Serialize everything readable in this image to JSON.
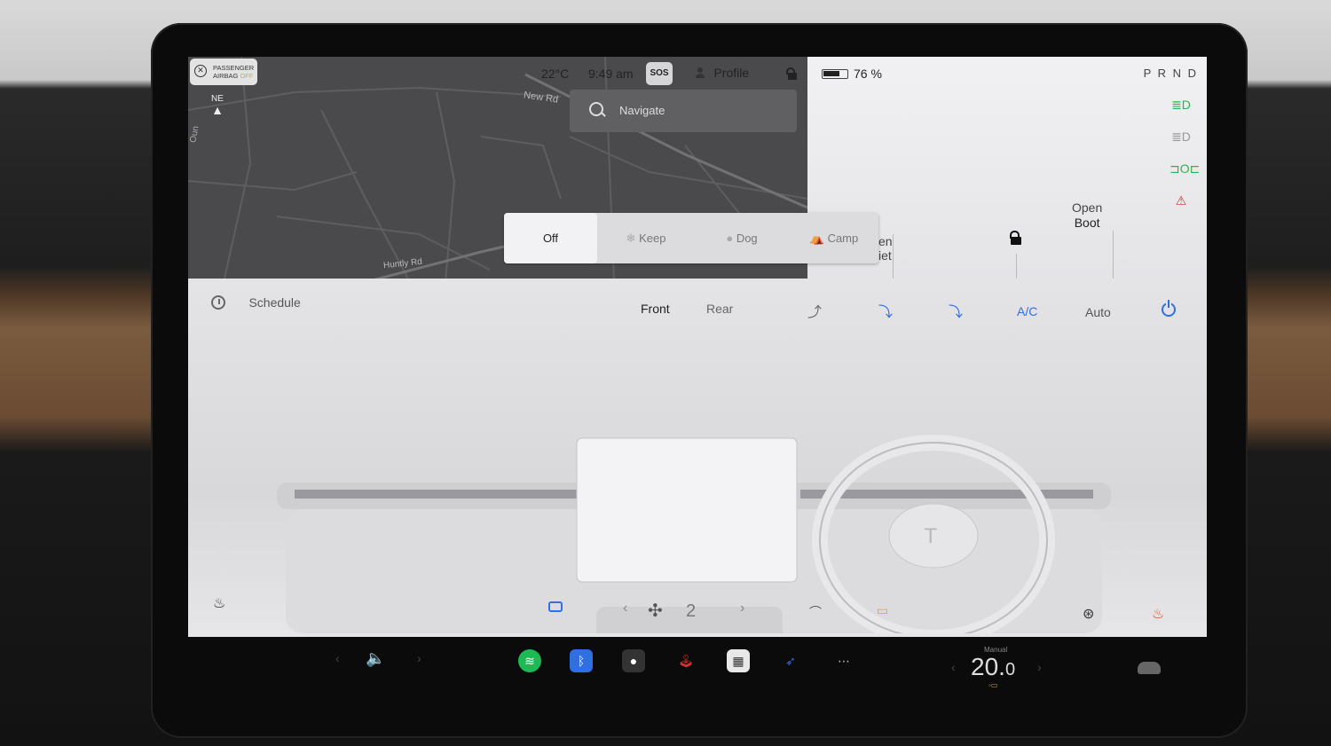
{
  "status": {
    "airbag_line1": "PASSENGER",
    "airbag_line2": "AIRBAG",
    "airbag_state": "OFF",
    "temperature": "22°C",
    "time": "9:49 am",
    "sos": "SOS",
    "profile": "Profile",
    "battery": "76 %",
    "battery_level": 0.76,
    "gear": "P R N D"
  },
  "map": {
    "compass": "NE",
    "roads": [
      "New Rd",
      "Huntly Rd",
      "Oun"
    ],
    "search_placeholder": "Navigate"
  },
  "modes": {
    "items": [
      "Off",
      "Keep",
      "Dog",
      "Camp"
    ],
    "selected": "Off"
  },
  "car_panel": {
    "frunk_partial_line1": "en",
    "frunk_partial_line2": "iet",
    "boot_line1": "Open",
    "boot_line2": "Boot"
  },
  "climate": {
    "schedule": "Schedule",
    "front": "Front",
    "rear": "Rear",
    "ac": "A/C",
    "auto": "Auto",
    "fan_speed": "2"
  },
  "bottom": {
    "temp_mode": "Manual",
    "cabin_temp_main": "20.",
    "cabin_temp_decimal": "0"
  },
  "colors": {
    "accent_blue": "#2f6fe0",
    "green_indicator": "#2fb24a",
    "red_indicator": "#d9302c",
    "seat_heat": "#e0502c"
  }
}
